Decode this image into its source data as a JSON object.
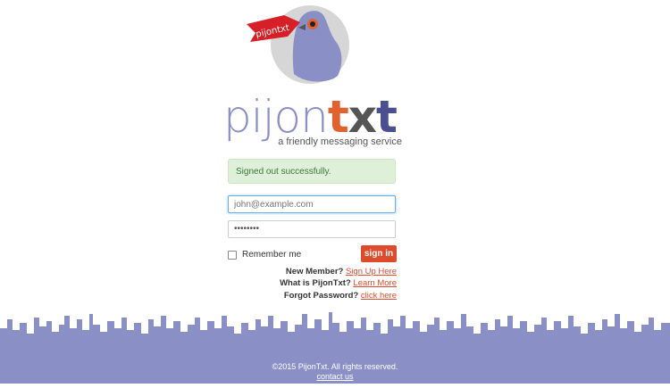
{
  "logo": {
    "ribbon_text": "pijontxt",
    "wordmark_part1": "pijon",
    "wordmark_part2": "t",
    "wordmark_part3": "x",
    "wordmark_part4": "t",
    "tagline": "a friendly messaging service"
  },
  "alert": {
    "message": "Signed out successfully."
  },
  "form": {
    "email_placeholder": "john@example.com",
    "password_value": "••••••••",
    "remember_label": "Remember me",
    "remember_checked": false,
    "signin_label": "sign in"
  },
  "links": {
    "new_member_prefix": "New Member?",
    "new_member_link": "Sign Up Here",
    "what_is_prefix": "What is PijonTxt?",
    "what_is_link": "Learn More",
    "forgot_prefix": "Forgot Password?",
    "forgot_link": "click here"
  },
  "footer": {
    "copyright": "©2015 PijonTxt. All rights reserved.",
    "contact": "contact us"
  },
  "colors": {
    "accent": "#dd4b2d",
    "brand_purple": "#8a8fc6",
    "skyline": "#8a8fc6",
    "alert_bg": "#dff0d8"
  }
}
